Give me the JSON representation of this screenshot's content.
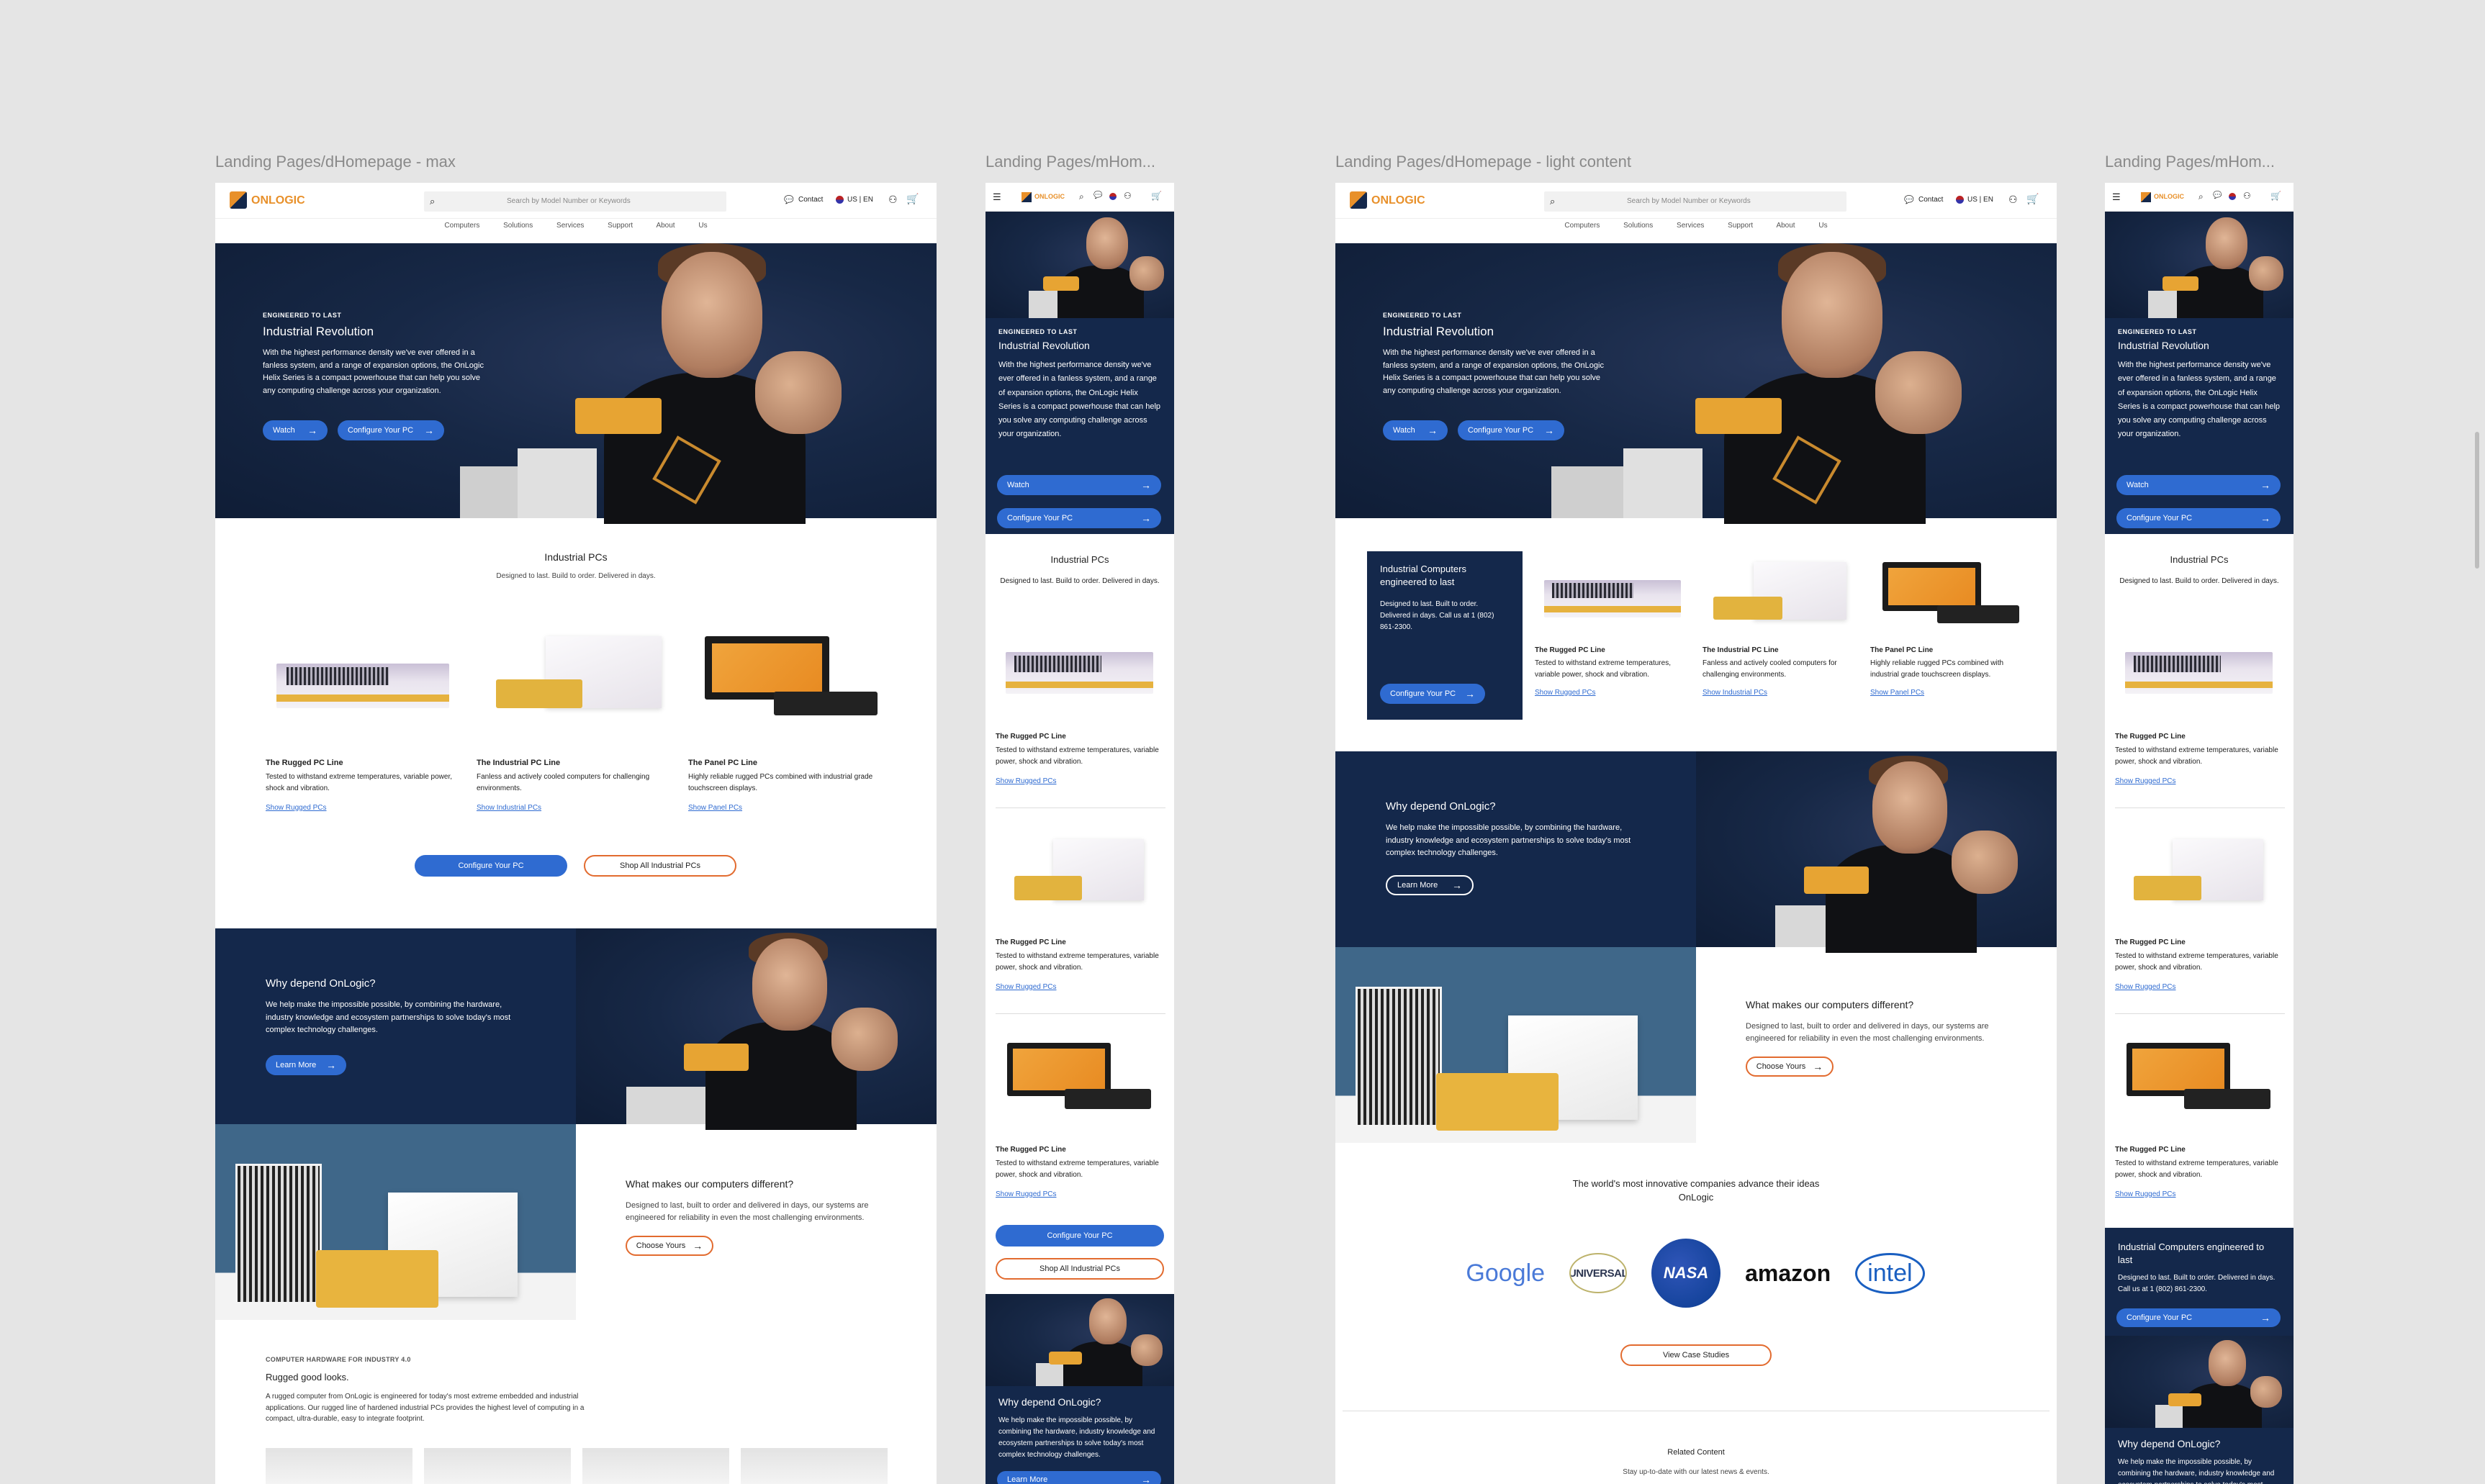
{
  "frames": {
    "f1": "Landing Pages/dHomepage - max",
    "f2": "Landing Pages/mHom...",
    "f3": "Landing Pages/dHomepage - light content",
    "f4": "Landing Pages/mHom..."
  },
  "colors": {
    "navy": "#14284b",
    "blue": "#2f6bd1",
    "orange": "#e26b2f",
    "brand_orange": "#e8902a"
  },
  "header": {
    "brand": "ONLOGIC",
    "search_placeholder": "Search by Model Number or Keywords",
    "contact": "Contact",
    "locale": "US | EN",
    "nav": [
      "Computers",
      "Solutions",
      "Services",
      "Support",
      "About Us"
    ],
    "icons": [
      "menu-icon",
      "search-icon",
      "chat-icon",
      "flag-icon",
      "user-icon",
      "cart-icon"
    ]
  },
  "hero": {
    "eyebrow": "ENGINEERED TO LAST",
    "title": "Industrial Revolution",
    "body": "With the highest performance density we've ever offered in a fanless system, and a range of expansion options, the OnLogic Helix Series is a compact powerhouse that can help you solve any computing challenge across your organization.",
    "watch": "Watch",
    "configure": "Configure Your PC"
  },
  "products": {
    "title": "Industrial PCs",
    "subtitle": "Designed to last. Build to order. Delivered in days.",
    "items": [
      {
        "name": "The Rugged PC Line",
        "desc": "Tested to withstand extreme temperatures, variable power, shock and vibration.",
        "link": "Show Rugged PCs"
      },
      {
        "name": "The Industrial PC Line",
        "desc": "Fanless and actively cooled computers for challenging environments.",
        "link": "Show Industrial PCs"
      },
      {
        "name": "The Panel PC Line",
        "desc": "Highly reliable rugged PCs combined with industrial grade touchscreen displays.",
        "link": "Show Panel PCs"
      }
    ],
    "mobile_items": [
      {
        "name": "The Rugged PC Line",
        "desc": "Tested to withstand extreme temperatures, variable power, shock and vibration.",
        "link": "Show Rugged PCs"
      }
    ],
    "configure": "Configure Your PC",
    "shop_all": "Shop All Industrial PCs"
  },
  "promo": {
    "title": "Industrial Computers engineered to last",
    "mtitle": "Industrial Computers engineered to last",
    "body": "Designed to last. Built to order. Delivered in days. Call us at 1 (802) 861-2300.",
    "cta": "Configure Your PC"
  },
  "why": {
    "title": "Why depend OnLogic?",
    "body": "We help make the impossible possible, by combining the hardware, industry knowledge and ecosystem partnerships to solve today's most complex technology challenges.",
    "cta": "Learn More"
  },
  "diff": {
    "title": "What makes our computers different?",
    "body": "Designed to last, built to order and delivered in days, our systems are engineered for reliability in even the most challenging environments.",
    "cta": "Choose Yours"
  },
  "rugged_looks": {
    "eyebrow": "COMPUTER HARDWARE FOR INDUSTRY 4.0",
    "title": "Rugged good looks.",
    "body": "A rugged computer from OnLogic is engineered for today's most extreme embedded and industrial applications. Our rugged line of hardened industrial PCs provides the highest level of computing in a compact, ultra-durable, easy to integrate footprint."
  },
  "logos": {
    "title": "The world's most innovative companies advance their ideas OnLogic",
    "google": "Google",
    "universal": "UNIVERSAL",
    "nasa": "NASA",
    "amazon": "amazon",
    "intel": "intel",
    "cta": "View Case Studies"
  },
  "related": {
    "title": "Related Content",
    "body": "Stay up-to-date with our latest news & events."
  }
}
